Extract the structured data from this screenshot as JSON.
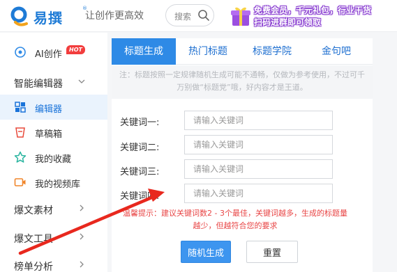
{
  "header": {
    "logo_text": "易撰",
    "logo_reg": "®",
    "slogan": "让创作更高效",
    "search_placeholder": "搜索",
    "promo": {
      "line1": "免费会员，千元礼包，行业干货",
      "line2": "扫码进群即可领取",
      "outline_color": "#8a3fd1"
    }
  },
  "sidebar": {
    "items": [
      {
        "label": "AI创作",
        "icon": "ai-icon",
        "badge": "HOT"
      },
      {
        "label": "智能编辑器",
        "type": "group",
        "expanded": true
      },
      {
        "label": "编辑器",
        "icon": "editor-icon",
        "active": true
      },
      {
        "label": "草稿箱",
        "icon": "draft-icon"
      },
      {
        "label": "我的收藏",
        "icon": "star-icon"
      },
      {
        "label": "我的视频库",
        "icon": "video-icon"
      },
      {
        "label": "爆文素材",
        "type": "group"
      },
      {
        "label": "爆文工具",
        "type": "group"
      },
      {
        "label": "榜单分析",
        "type": "group"
      }
    ]
  },
  "main": {
    "tabs": [
      {
        "label": "标题生成",
        "active": true
      },
      {
        "label": "热门标题"
      },
      {
        "label": "标题学院"
      },
      {
        "label": "金句吧"
      }
    ],
    "note": "注：标题按照一定规律随机生成可能不通畅，仅做为参考使用，不过可千万别做“标题党”哦，好内容才是王道。",
    "fields": [
      {
        "label": "关键词一:",
        "placeholder": "请输入关键词",
        "value": ""
      },
      {
        "label": "关键词二:",
        "placeholder": "请输入关键词",
        "value": ""
      },
      {
        "label": "关键词三:",
        "placeholder": "请输入关键词",
        "value": ""
      },
      {
        "label": "关键词四:",
        "placeholder": "请输入关键词",
        "value": ""
      }
    ],
    "tip": "温馨提示：建议关键词数2 - 3个最佳，关键词越多，生成的标题量越少，但越符合您的要求",
    "buttons": {
      "generate": "随机生成",
      "reset": "重置"
    }
  },
  "colors": {
    "accent": "#2e8ae6",
    "active_nav_bg": "#eaf3fd",
    "tip_red": "#e84545",
    "annotation_arrow": "#e8281e"
  }
}
